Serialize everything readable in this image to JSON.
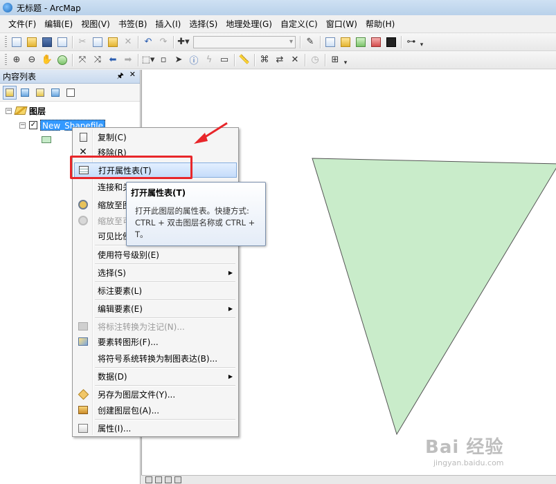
{
  "window": {
    "title": "无标题 - ArcMap"
  },
  "menubar": [
    "文件(F)",
    "编辑(E)",
    "视图(V)",
    "书签(B)",
    "插入(I)",
    "选择(S)",
    "地理处理(G)",
    "自定义(C)",
    "窗口(W)",
    "帮助(H)"
  ],
  "toc": {
    "title": "内容列表",
    "pin": "🖈",
    "close": "✕",
    "group_label": "图层",
    "layer_label": "New_Shapefile",
    "group_expander": "−",
    "layer_expander": "−",
    "layer_check": "✓"
  },
  "context_menu": {
    "items": [
      {
        "label": "复制(C)",
        "icon": "copy-icon",
        "enabled": true
      },
      {
        "label": "移除(R)",
        "icon": "remove-icon",
        "enabled": true
      },
      {
        "label": "打开属性表(T)",
        "icon": "table-icon",
        "enabled": true,
        "highlighted": true
      },
      {
        "label": "连接和关",
        "icon": "",
        "enabled": true
      },
      {
        "label": "缩放至图",
        "icon": "zoom-to-layer-icon",
        "enabled": true
      },
      {
        "label": "缩放至可",
        "icon": "zoom-visible-icon",
        "enabled": false
      },
      {
        "label": "可见比例",
        "icon": "",
        "enabled": true
      },
      {
        "label": "使用符号级别(E)",
        "icon": "",
        "enabled": true
      },
      {
        "label": "选择(S)",
        "icon": "",
        "enabled": true,
        "submenu": true
      },
      {
        "label": "标注要素(L)",
        "icon": "",
        "enabled": true
      },
      {
        "label": "编辑要素(E)",
        "icon": "",
        "enabled": true,
        "submenu": true
      },
      {
        "label": "将标注转换为注记(N)...",
        "icon": "convert-labels-icon",
        "enabled": false
      },
      {
        "label": "要素转图形(F)...",
        "icon": "features-to-graphics-icon",
        "enabled": true
      },
      {
        "label": "将符号系统转换为制图表达(B)...",
        "icon": "",
        "enabled": true
      },
      {
        "label": "数据(D)",
        "icon": "",
        "enabled": true,
        "submenu": true
      },
      {
        "label": "另存为图层文件(Y)...",
        "icon": "layer-file-icon",
        "enabled": true
      },
      {
        "label": "创建图层包(A)...",
        "icon": "layer-package-icon",
        "enabled": true
      },
      {
        "label": "属性(I)...",
        "icon": "properties-icon",
        "enabled": true
      }
    ],
    "submenu_arrow": "▶"
  },
  "tooltip": {
    "title": "打开属性表(T)",
    "line1": "打开此图层的属性表。快捷方式:",
    "line2": "CTRL + 双击图层名称或 CTRL +",
    "line3": "T。"
  },
  "map": {
    "polygon_fill": "#c9ecca",
    "polygon_stroke": "#555555"
  },
  "colors": {
    "highlight_box": "#e8262a",
    "selection": "#3399ff"
  },
  "watermark": {
    "main": "Bai 经验",
    "sub": "jingyan.baidu.com"
  }
}
